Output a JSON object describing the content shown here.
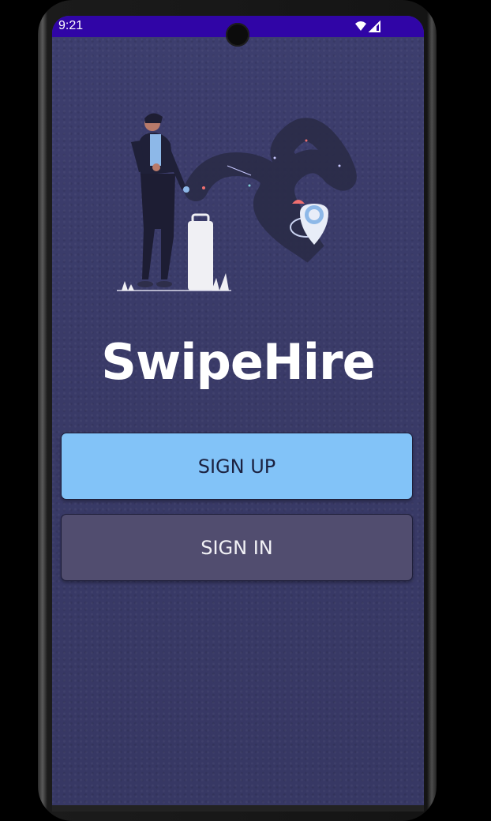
{
  "status_bar": {
    "time": "9:21",
    "icons": [
      "wifi-icon",
      "cell-signal-icon"
    ]
  },
  "app": {
    "title": "SwipeHire",
    "illustration": "person-with-luggage-and-path-illustration"
  },
  "buttons": {
    "sign_up": "SIGN UP",
    "sign_in": "SIGN IN"
  },
  "colors": {
    "status_bar": "#3005a6",
    "background": "#3a3b69",
    "sign_up_bg": "#82c3f8",
    "sign_in_bg": "#514d6f"
  }
}
